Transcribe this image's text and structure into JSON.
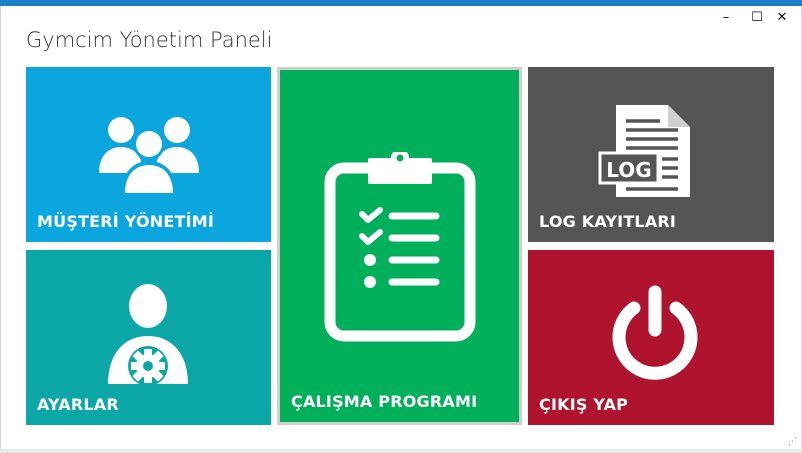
{
  "window": {
    "title": "Gymcim Yönetim Paneli",
    "controls": {
      "minimize": "–",
      "maximize": "☐",
      "close": "✕"
    }
  },
  "tiles": {
    "musteri": {
      "label": "MÜŞTERİ YÖNETİMİ",
      "icon": "users-icon",
      "color": "#0aa6dd"
    },
    "ayarlar": {
      "label": "AYARLAR",
      "icon": "user-settings-icon",
      "color": "#0aa7a6"
    },
    "calisma": {
      "label": "ÇALIŞMA PROGRAMI",
      "icon": "clipboard-checklist-icon",
      "color": "#00af5a"
    },
    "log": {
      "label": "LOG KAYITLARI",
      "icon": "log-document-icon",
      "color": "#555555",
      "icon_text": "LOG"
    },
    "cikis": {
      "label": "ÇIKIŞ YAP",
      "icon": "power-icon",
      "color": "#b0132e"
    }
  }
}
